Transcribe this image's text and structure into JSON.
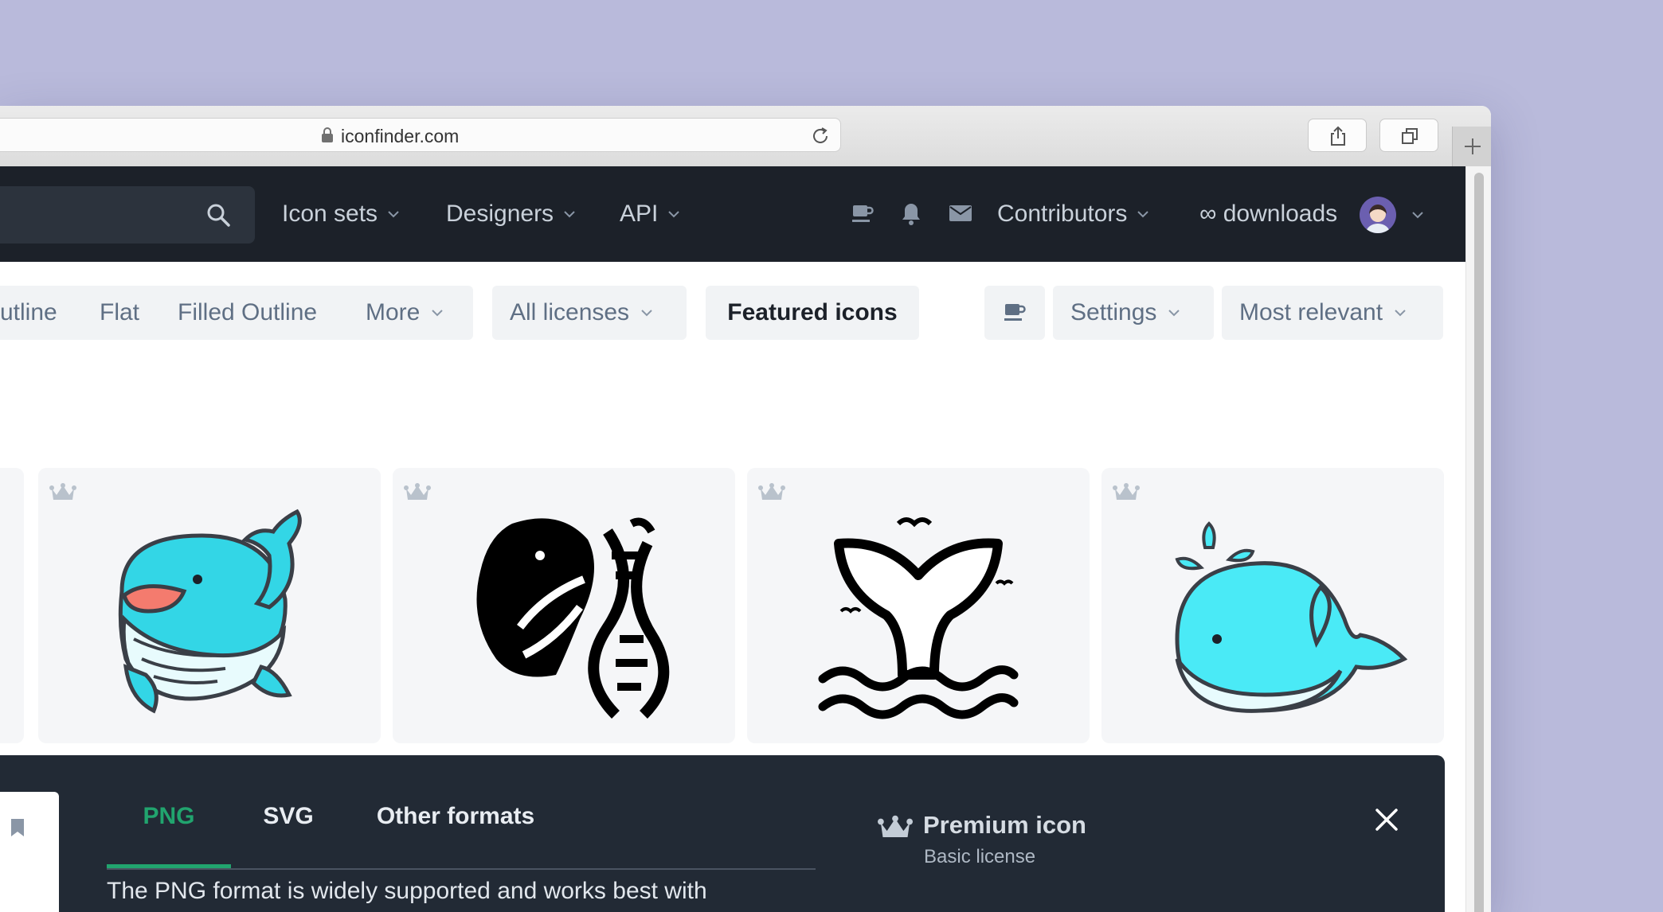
{
  "browser": {
    "url": "iconfinder.com",
    "icons": [
      "lock-icon",
      "reload-icon",
      "share-icon",
      "tabs-icon",
      "new-tab-icon"
    ]
  },
  "nav": {
    "search_icon": "search-icon",
    "items": [
      {
        "label": "Icon sets"
      },
      {
        "label": "Designers"
      },
      {
        "label": "API"
      }
    ],
    "right_icons": [
      "coffee-icon",
      "bell-icon",
      "mail-icon"
    ],
    "contributors": "Contributors",
    "downloads": "∞ downloads"
  },
  "filters": {
    "styles": [
      "utline",
      "Flat",
      "Filled Outline",
      "More"
    ],
    "license": "All licenses",
    "featured": "Featured icons",
    "settings": "Settings",
    "sort": "Most relevant"
  },
  "cards": [
    {
      "name": "cartoon-whale",
      "badge": "premium-crown-icon"
    },
    {
      "name": "whale-dna",
      "badge": "premium-crown-icon"
    },
    {
      "name": "whale-tail-waves",
      "badge": "premium-crown-icon"
    },
    {
      "name": "cute-whale-spout",
      "badge": "premium-crown-icon"
    }
  ],
  "panel": {
    "tabs": [
      {
        "label": "PNG",
        "active": true
      },
      {
        "label": "SVG",
        "active": false
      },
      {
        "label": "Other formats",
        "active": false
      }
    ],
    "description": "The PNG format is widely supported and works best with",
    "premium_title": "Premium icon",
    "premium_sub": "Basic license",
    "accent": "#21a46e"
  }
}
